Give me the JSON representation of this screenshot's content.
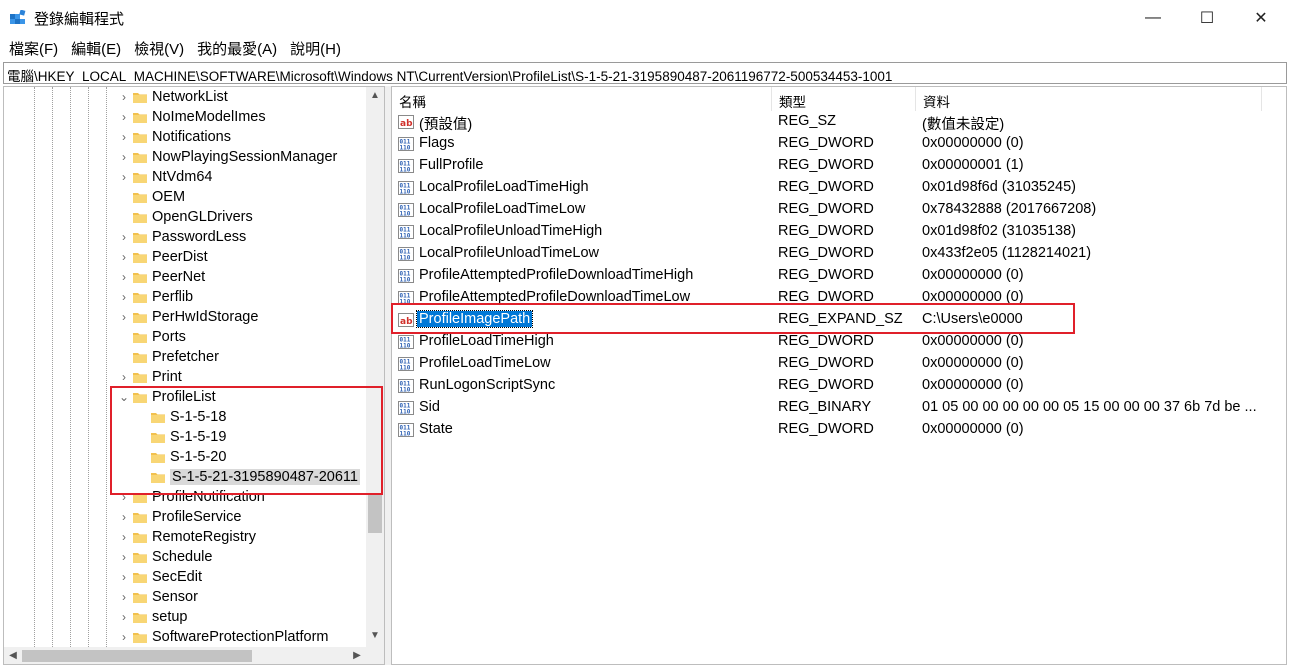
{
  "window": {
    "title": "登錄編輯程式",
    "minimize_glyph": "—",
    "maximize_glyph": "☐",
    "close_glyph": "✕"
  },
  "menu": [
    "檔案(F)",
    "編輯(E)",
    "檢視(V)",
    "我的最愛(A)",
    "說明(H)"
  ],
  "address": "電腦\\HKEY_LOCAL_MACHINE\\SOFTWARE\\Microsoft\\Windows NT\\CurrentVersion\\ProfileList\\S-1-5-21-3195890487-2061196772-500534453-1001",
  "tree": {
    "items": [
      {
        "label": "NetworkList",
        "level": 0,
        "expandable": true
      },
      {
        "label": "NoImeModelImes",
        "level": 0,
        "expandable": true
      },
      {
        "label": "Notifications",
        "level": 0,
        "expandable": true
      },
      {
        "label": "NowPlayingSessionManager",
        "level": 0,
        "expandable": true
      },
      {
        "label": "NtVdm64",
        "level": 0,
        "expandable": true
      },
      {
        "label": "OEM",
        "level": 0,
        "expandable": false
      },
      {
        "label": "OpenGLDrivers",
        "level": 0,
        "expandable": false
      },
      {
        "label": "PasswordLess",
        "level": 0,
        "expandable": true
      },
      {
        "label": "PeerDist",
        "level": 0,
        "expandable": true
      },
      {
        "label": "PeerNet",
        "level": 0,
        "expandable": true
      },
      {
        "label": "Perflib",
        "level": 0,
        "expandable": true
      },
      {
        "label": "PerHwIdStorage",
        "level": 0,
        "expandable": true
      },
      {
        "label": "Ports",
        "level": 0,
        "expandable": false
      },
      {
        "label": "Prefetcher",
        "level": 0,
        "expandable": false
      },
      {
        "label": "Print",
        "level": 0,
        "expandable": true
      },
      {
        "label": "ProfileList",
        "level": 0,
        "expandable": true,
        "expanded": true
      },
      {
        "label": "S-1-5-18",
        "level": 1,
        "expandable": false
      },
      {
        "label": "S-1-5-19",
        "level": 1,
        "expandable": false
      },
      {
        "label": "S-1-5-20",
        "level": 1,
        "expandable": false
      },
      {
        "label": "S-1-5-21-3195890487-20611",
        "level": 1,
        "expandable": false,
        "selected": true
      },
      {
        "label": "ProfileNotification",
        "level": 0,
        "expandable": true
      },
      {
        "label": "ProfileService",
        "level": 0,
        "expandable": true
      },
      {
        "label": "RemoteRegistry",
        "level": 0,
        "expandable": true
      },
      {
        "label": "Schedule",
        "level": 0,
        "expandable": true
      },
      {
        "label": "SecEdit",
        "level": 0,
        "expandable": true
      },
      {
        "label": "Sensor",
        "level": 0,
        "expandable": true
      },
      {
        "label": "setup",
        "level": 0,
        "expandable": true
      },
      {
        "label": "SoftwareProtectionPlatform",
        "level": 0,
        "expandable": true
      }
    ]
  },
  "list": {
    "columns": [
      "名稱",
      "類型",
      "資料"
    ],
    "rows": [
      {
        "icon": "string-value-icon",
        "name": "(預設值)",
        "type": "REG_SZ",
        "data": "(數值未設定)"
      },
      {
        "icon": "binary-value-icon",
        "name": "Flags",
        "type": "REG_DWORD",
        "data": "0x00000000 (0)"
      },
      {
        "icon": "binary-value-icon",
        "name": "FullProfile",
        "type": "REG_DWORD",
        "data": "0x00000001 (1)"
      },
      {
        "icon": "binary-value-icon",
        "name": "LocalProfileLoadTimeHigh",
        "type": "REG_DWORD",
        "data": "0x01d98f6d (31035245)"
      },
      {
        "icon": "binary-value-icon",
        "name": "LocalProfileLoadTimeLow",
        "type": "REG_DWORD",
        "data": "0x78432888 (2017667208)"
      },
      {
        "icon": "binary-value-icon",
        "name": "LocalProfileUnloadTimeHigh",
        "type": "REG_DWORD",
        "data": "0x01d98f02 (31035138)"
      },
      {
        "icon": "binary-value-icon",
        "name": "LocalProfileUnloadTimeLow",
        "type": "REG_DWORD",
        "data": "0x433f2e05 (1128214021)"
      },
      {
        "icon": "binary-value-icon",
        "name": "ProfileAttemptedProfileDownloadTimeHigh",
        "type": "REG_DWORD",
        "data": "0x00000000 (0)"
      },
      {
        "icon": "binary-value-icon",
        "name": "ProfileAttemptedProfileDownloadTimeLow",
        "type": "REG_DWORD",
        "data": "0x00000000 (0)"
      },
      {
        "icon": "string-value-icon",
        "name": "ProfileImagePath",
        "type": "REG_EXPAND_SZ",
        "data": "C:\\Users\\e0000",
        "selected": true
      },
      {
        "icon": "binary-value-icon",
        "name": "ProfileLoadTimeHigh",
        "type": "REG_DWORD",
        "data": "0x00000000 (0)"
      },
      {
        "icon": "binary-value-icon",
        "name": "ProfileLoadTimeLow",
        "type": "REG_DWORD",
        "data": "0x00000000 (0)"
      },
      {
        "icon": "binary-value-icon",
        "name": "RunLogonScriptSync",
        "type": "REG_DWORD",
        "data": "0x00000000 (0)"
      },
      {
        "icon": "binary-value-icon",
        "name": "Sid",
        "type": "REG_BINARY",
        "data": "01 05 00 00 00 00 00 05 15 00 00 00 37 6b 7d be ..."
      },
      {
        "icon": "binary-value-icon",
        "name": "State",
        "type": "REG_DWORD",
        "data": "0x00000000 (0)"
      }
    ]
  },
  "colors": {
    "highlight_box": "#e0202a",
    "selection": "#0078d7",
    "folder": "#f2c14e"
  }
}
